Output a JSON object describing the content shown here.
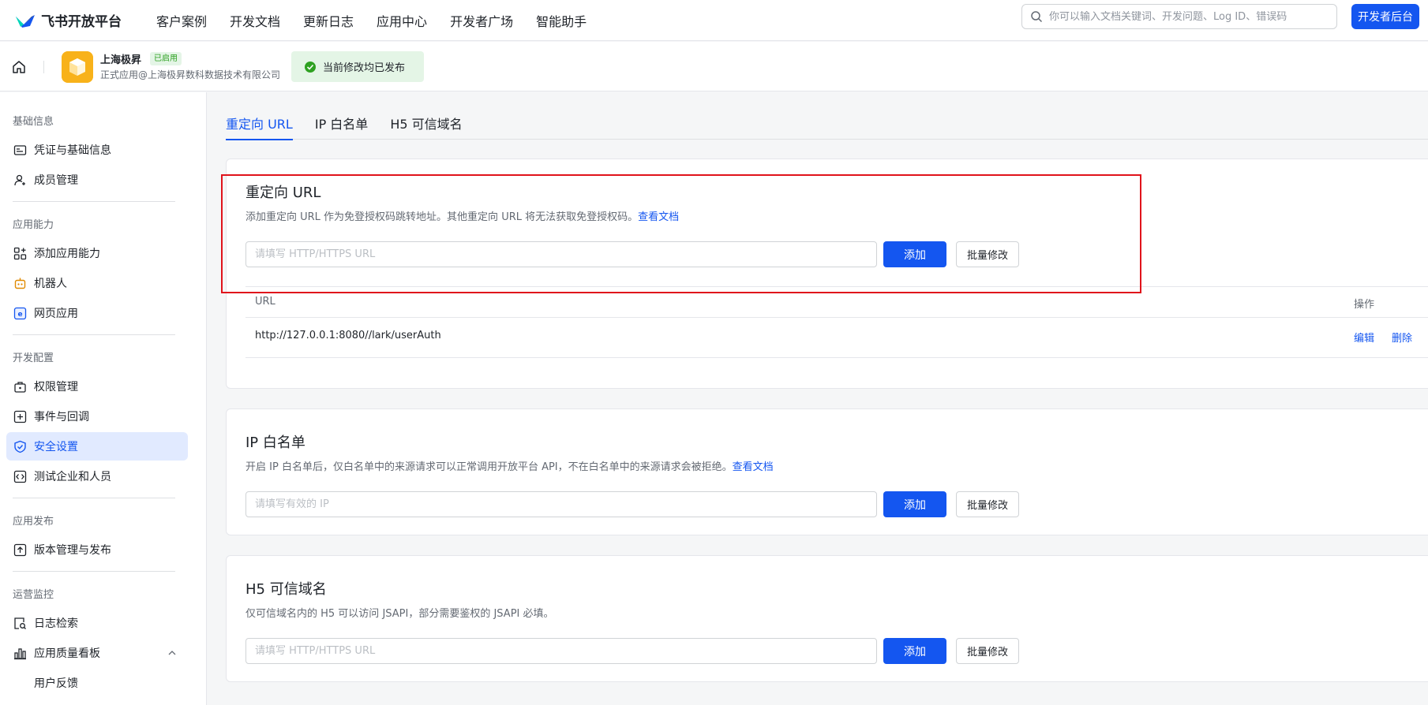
{
  "topbar": {
    "brand": "飞书开放平台",
    "nav": [
      "客户案例",
      "开发文档",
      "更新日志",
      "应用中心",
      "开发者广场",
      "智能助手"
    ],
    "search_placeholder": "你可以输入文档关键词、开发问题、Log ID、错误码",
    "dev_console": "开发者后台"
  },
  "app": {
    "name": "上海极昇",
    "badge": "已启用",
    "subtitle": "正式应用@上海极昇数科数据技术有限公司",
    "publish_status": "当前修改均已发布"
  },
  "sidebar": {
    "groups": [
      "基础信息",
      "应用能力",
      "开发配置",
      "应用发布",
      "运营监控"
    ],
    "items": [
      {
        "label": "凭证与基础信息",
        "icon": "credential-icon"
      },
      {
        "label": "成员管理",
        "icon": "member-icon"
      },
      {
        "label": "添加应用能力",
        "icon": "add-capability-icon"
      },
      {
        "label": "机器人",
        "icon": "robot-icon"
      },
      {
        "label": "网页应用",
        "icon": "web-app-icon"
      },
      {
        "label": "权限管理",
        "icon": "permission-icon"
      },
      {
        "label": "事件与回调",
        "icon": "event-icon"
      },
      {
        "label": "安全设置",
        "icon": "shield-icon"
      },
      {
        "label": "测试企业和人员",
        "icon": "test-icon"
      },
      {
        "label": "版本管理与发布",
        "icon": "release-icon"
      },
      {
        "label": "日志检索",
        "icon": "log-search-icon"
      },
      {
        "label": "应用质量看板",
        "icon": "dashboard-icon"
      },
      {
        "label": "用户反馈",
        "icon": ""
      }
    ]
  },
  "tabs": [
    "重定向 URL",
    "IP 白名单",
    "H5 可信域名"
  ],
  "redirect": {
    "title": "重定向 URL",
    "desc": "添加重定向 URL 作为免登授权码跳转地址。其他重定向 URL 将无法获取免登授权码。",
    "doc_link": "查看文档",
    "placeholder": "请填写 HTTP/HTTPS URL",
    "add": "添加",
    "batch": "批量修改",
    "col_url": "URL",
    "col_ops": "操作",
    "rows": [
      {
        "url": "http://127.0.0.1:8080//lark/userAuth",
        "edit": "编辑",
        "delete": "删除"
      }
    ]
  },
  "ipwhitelist": {
    "title": "IP 白名单",
    "desc": "开启 IP 白名单后，仅白名单中的来源请求可以正常调用开放平台 API，不在白名单中的来源请求会被拒绝。",
    "doc_link": "查看文档",
    "placeholder": "请填写有效的 IP",
    "add": "添加",
    "batch": "批量修改"
  },
  "h5domain": {
    "title": "H5 可信域名",
    "desc": "仅可信域名内的 H5 可以访问 JSAPI，部分需要鉴权的 JSAPI 必填。",
    "placeholder": "请填写 HTTP/HTTPS URL",
    "add": "添加",
    "batch": "批量修改"
  },
  "colors": {
    "primary": "#1456f0",
    "success": "#2ea121",
    "highlight": "#e0131b"
  }
}
